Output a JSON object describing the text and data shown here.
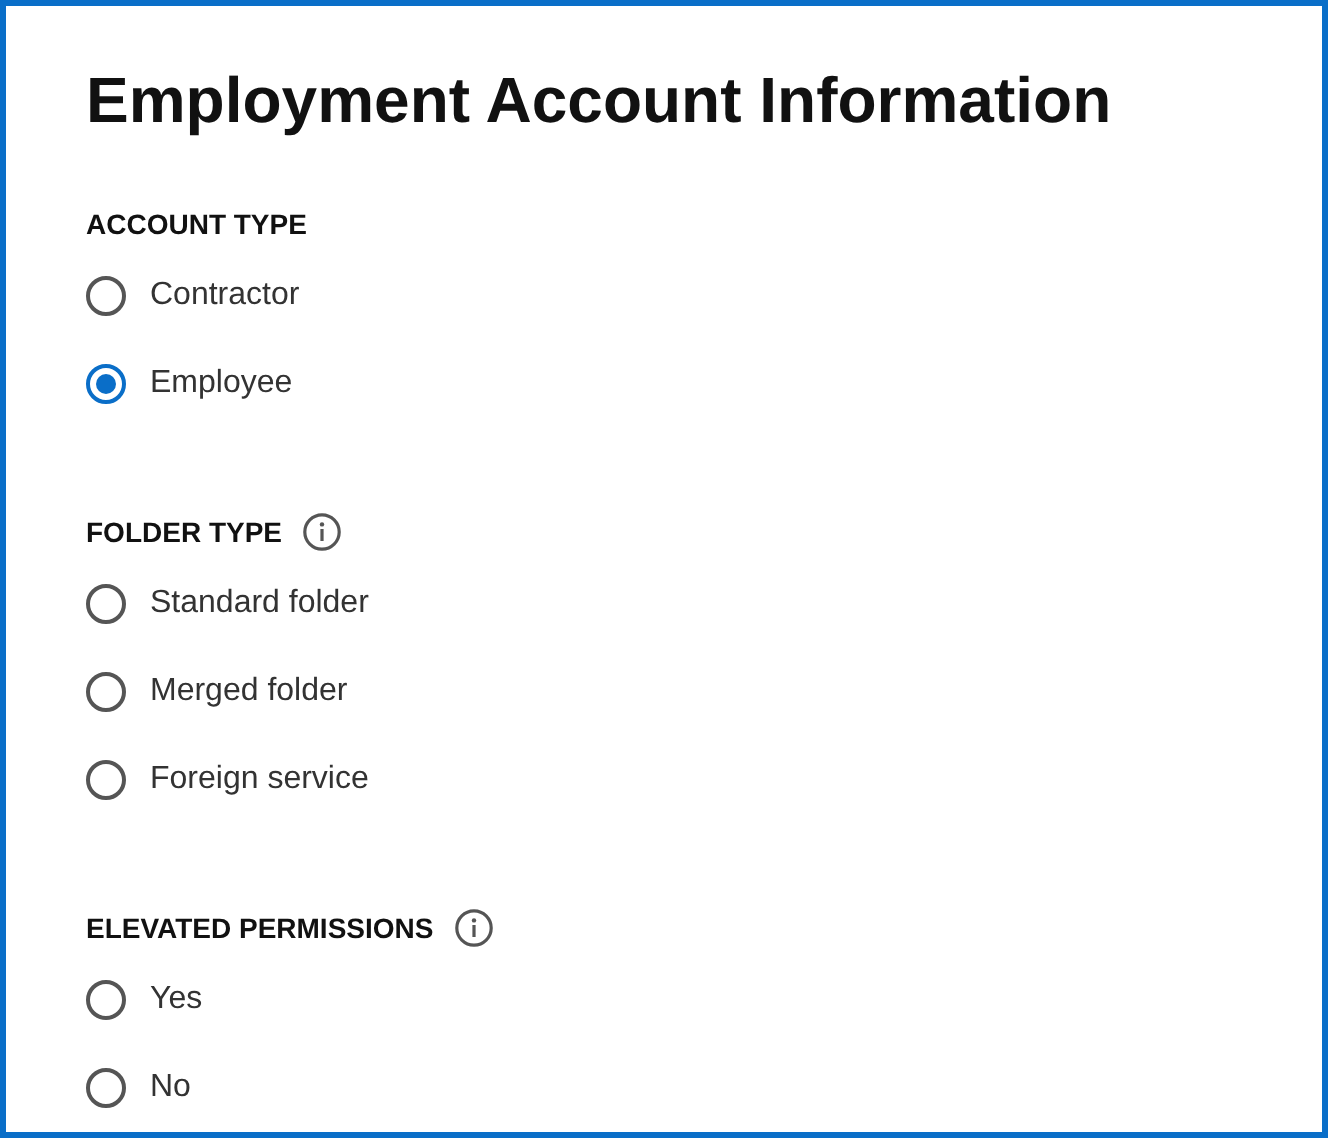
{
  "title": "Employment Account Information",
  "sections": [
    {
      "label": "ACCOUNT TYPE",
      "info": false,
      "options": [
        {
          "label": "Contractor",
          "selected": false
        },
        {
          "label": "Employee",
          "selected": true
        }
      ]
    },
    {
      "label": "FOLDER TYPE",
      "info": true,
      "options": [
        {
          "label": "Standard folder",
          "selected": false
        },
        {
          "label": "Merged folder",
          "selected": false
        },
        {
          "label": "Foreign service",
          "selected": false
        }
      ]
    },
    {
      "label": "ELEVATED PERMISSIONS",
      "info": true,
      "options": [
        {
          "label": "Yes",
          "selected": false
        },
        {
          "label": "No",
          "selected": false
        }
      ]
    }
  ]
}
